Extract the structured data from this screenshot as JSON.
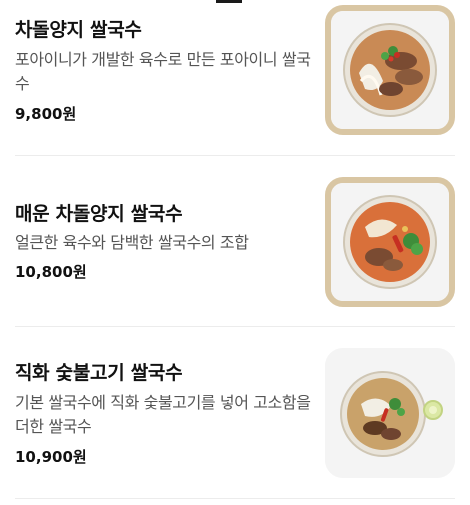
{
  "colors": {
    "background": "#ffffff",
    "text_primary": "#111111",
    "text_secondary": "#555555",
    "divider": "#ececec",
    "thumb_frame": "#d9c6a3",
    "thumb_bg": "#f4f4f4"
  },
  "menu": {
    "items": [
      {
        "name": "차돌양지 쌀국수",
        "description": "포아이니가 개발한 육수로 만든 포아이니 쌀국수",
        "price": "9,800원",
        "image_icon": "pho-bowl-icon",
        "highlighted": true
      },
      {
        "name": "매운 차돌양지 쌀국수",
        "description": "얼큰한 육수와 담백한 쌀국수의 조합",
        "price": "10,800원",
        "image_icon": "spicy-pho-bowl-icon",
        "highlighted": true
      },
      {
        "name": "직화 숯불고기 쌀국수",
        "description": "기본 쌀국수에 직화 숯불고기를 넣어 고소함을 더한 쌀국수",
        "price": "10,900원",
        "image_icon": "grilled-pork-pho-bowl-icon",
        "highlighted": false
      }
    ]
  }
}
